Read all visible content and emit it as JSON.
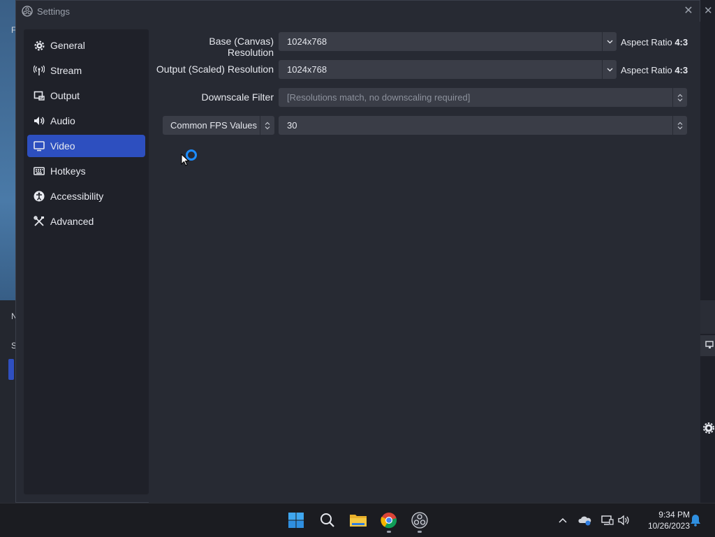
{
  "window": {
    "title": "Settings",
    "close_label": "✕"
  },
  "background": {
    "left_letters": [
      "F",
      "N",
      "S"
    ],
    "right_close": "✕"
  },
  "sidebar": {
    "items": [
      {
        "label": "General",
        "icon": "gear-icon",
        "active": false
      },
      {
        "label": "Stream",
        "icon": "antenna-icon",
        "active": false
      },
      {
        "label": "Output",
        "icon": "output-icon",
        "active": false
      },
      {
        "label": "Audio",
        "icon": "speaker-icon",
        "active": false
      },
      {
        "label": "Video",
        "icon": "monitor-icon",
        "active": true
      },
      {
        "label": "Hotkeys",
        "icon": "keyboard-icon",
        "active": false
      },
      {
        "label": "Accessibility",
        "icon": "accessibility-icon",
        "active": false
      },
      {
        "label": "Advanced",
        "icon": "tools-icon",
        "active": false
      }
    ]
  },
  "video": {
    "base_resolution": {
      "label": "Base (Canvas) Resolution",
      "value": "1024x768",
      "aspect_prefix": "Aspect Ratio",
      "aspect_value": "4:3"
    },
    "output_resolution": {
      "label": "Output (Scaled) Resolution",
      "value": "1024x768",
      "aspect_prefix": "Aspect Ratio",
      "aspect_value": "4:3"
    },
    "downscale_filter": {
      "label": "Downscale Filter",
      "value": "[Resolutions match, no downscaling required]"
    },
    "fps": {
      "type_label": "Common FPS Values",
      "value": "30"
    }
  },
  "taskbar": {
    "apps": [
      "start-icon",
      "search-icon",
      "file-explorer-icon",
      "chrome-icon",
      "obs-icon"
    ],
    "time": "9:34 PM",
    "date": "10/26/2023"
  },
  "colors": {
    "accent": "#2d4fbf",
    "spinner": "#1c8cff",
    "dialog_bg": "#272a33",
    "sidebar_bg": "#1f2129",
    "field_bg": "#3a3d47"
  }
}
